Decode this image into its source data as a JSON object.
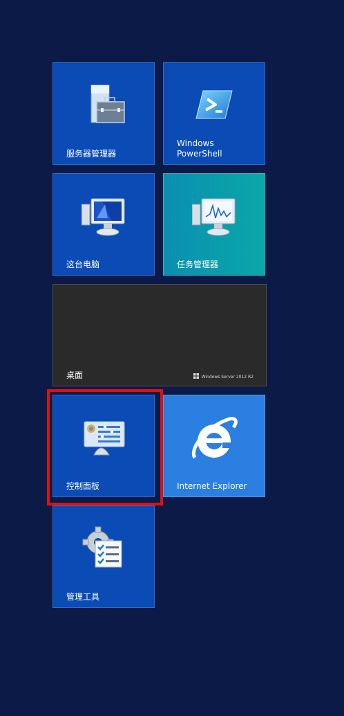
{
  "tiles": {
    "server_manager": {
      "label": "服务器管理器",
      "color": "#0a4bb5",
      "icon": "server-manager-icon"
    },
    "powershell": {
      "label": "Windows\nPowerShell",
      "color": "#0a4bb5",
      "icon": "powershell-icon"
    },
    "this_pc": {
      "label": "这台电脑",
      "color": "#0a4bb5",
      "icon": "computer-icon"
    },
    "task_manager": {
      "label": "任务管理器",
      "color": "#0aa0a8",
      "icon": "task-manager-icon"
    },
    "desktop": {
      "label": "桌面",
      "color": "#2a2a2a",
      "badge": "Windows Server 2012 R2"
    },
    "control_panel": {
      "label": "控制面板",
      "color": "#0a4bb5",
      "icon": "control-panel-icon"
    },
    "internet_explorer": {
      "label": "Internet Explorer",
      "color": "#2a7fe0",
      "icon": "ie-icon"
    },
    "admin_tools": {
      "label": "管理工具",
      "color": "#0a4bb5",
      "icon": "admin-tools-icon"
    }
  },
  "highlight_color": "#e20f10",
  "background_color": "#0b1a46"
}
